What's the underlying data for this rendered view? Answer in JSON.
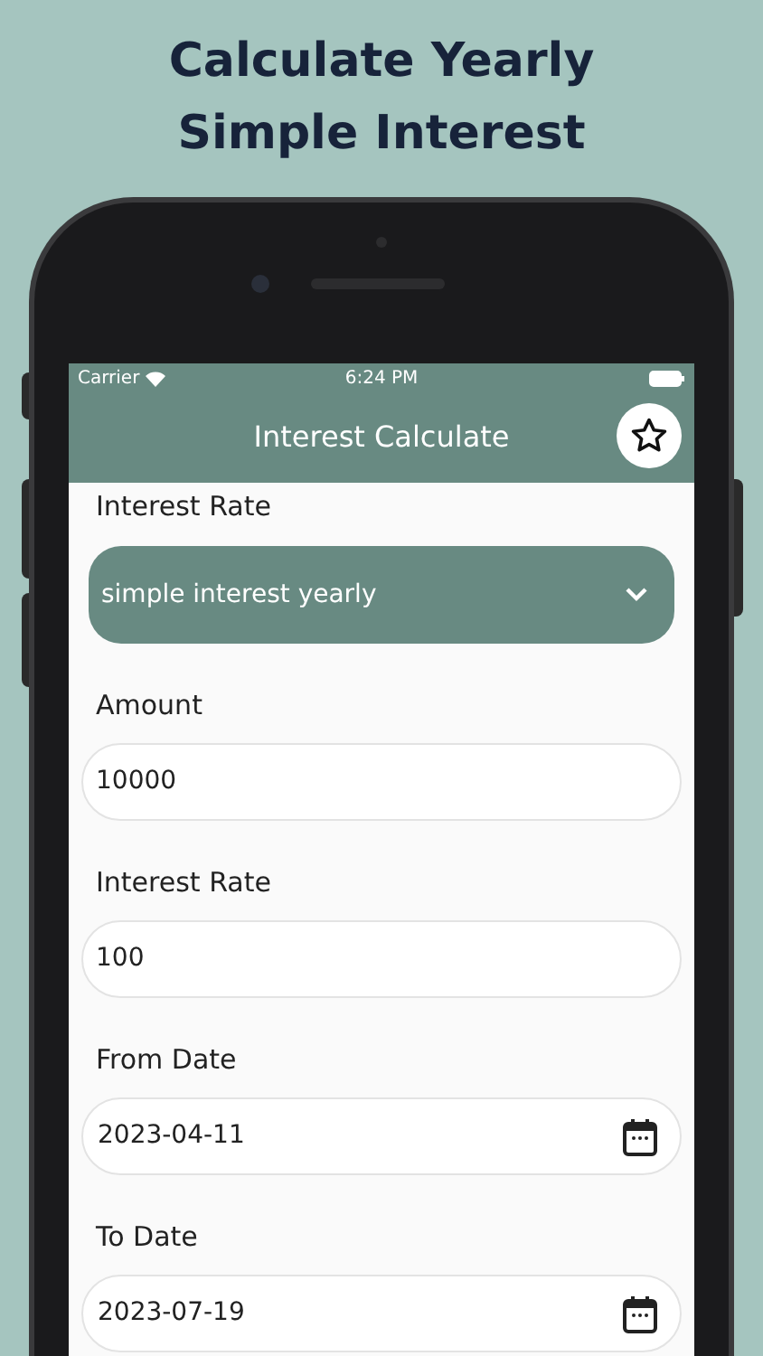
{
  "headline": [
    "Calculate Yearly",
    "Simple Interest"
  ],
  "status_bar": {
    "carrier": "Carrier",
    "time": "6:24 PM"
  },
  "app_bar": {
    "title": "Interest Calculate"
  },
  "fields": [
    {
      "kind": "dropdown",
      "label": "Interest Rate",
      "value": "simple interest yearly"
    },
    {
      "kind": "text",
      "label": "Amount",
      "value": "10000"
    },
    {
      "kind": "text",
      "label": "Interest Rate",
      "value": "100"
    },
    {
      "kind": "date",
      "label": "From Date",
      "value": "2023-04-11"
    },
    {
      "kind": "date",
      "label": "To Date",
      "value": "2023-07-19"
    }
  ]
}
